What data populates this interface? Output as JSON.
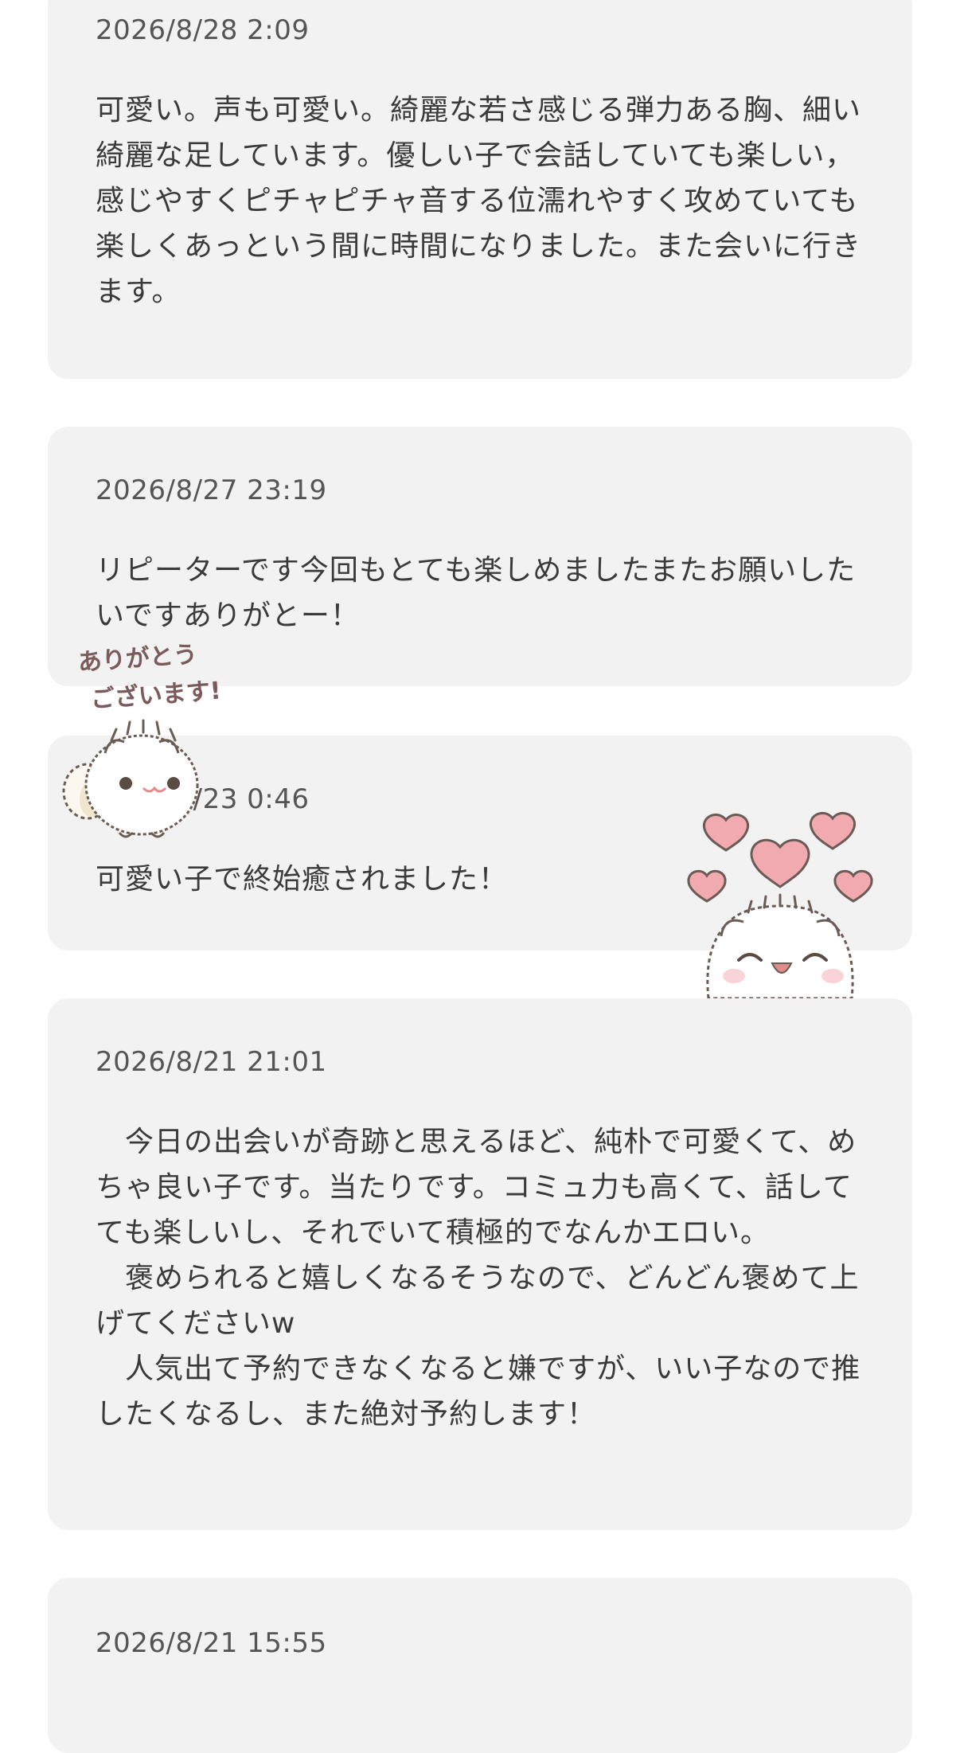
{
  "reviews": [
    {
      "date": "2026/8/28 2:09",
      "text": "可愛い。声も可愛い。綺麗な若さ感じる弾力ある胸、細い綺麗な足しています。優しい子で会話していても楽しい，感じやすくピチャピチャ音する位濡れやすく攻めていても楽しくあっという間に時間になりました。また会いに行きます。"
    },
    {
      "date": "2026/8/27 23:19",
      "text": "リピーターです今回もとても楽しめましたまたお願いしたいですありがとー！"
    },
    {
      "date": "2026/8/23 0:46",
      "text": "可愛い子で終始癒されました！"
    },
    {
      "date": "2026/8/21 21:01",
      "text": "　今日の出会いが奇跡と思えるほど、純朴で可愛くて、めちゃ良い子です。当たりです。コミュ力も高くて、話してても楽しいし、それでいて積極的でなんかエロい。\n　褒められると嬉しくなるそうなので、どんどん褒めて上げてくださいw\n　人気出て予約できなくなると嫌ですが、いい子なので推したくなるし、また絶対予約します！"
    },
    {
      "date": "2026/8/21 15:55",
      "text": ""
    }
  ],
  "stickers": {
    "thanks": {
      "line1": "ありがとう",
      "line2": "ございます!",
      "icon": "fluffy-cat-thanks-sticker",
      "color": "#7a5a5a"
    },
    "hearts": {
      "icon": "fluffy-cat-hearts-sticker",
      "heart_color": "#f1aab0"
    }
  },
  "colors": {
    "card_background": "#f2f2f2",
    "page_background": "#ffffff",
    "text": "#3a3a3a",
    "date_text": "#555555"
  }
}
